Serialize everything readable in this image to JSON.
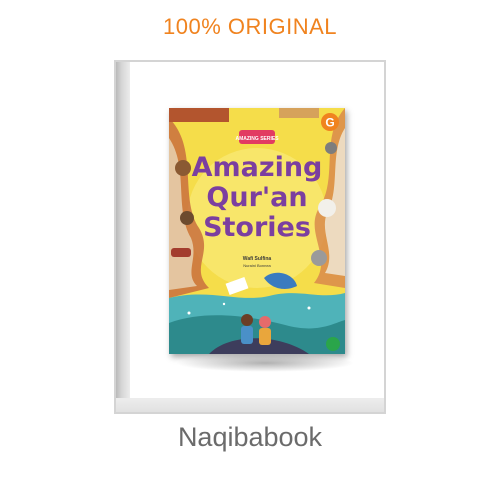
{
  "header": {
    "label": "100% ORIGINAL",
    "color": "#f0831f"
  },
  "footer": {
    "label": "Naqibabook",
    "color": "#6b6b6b"
  },
  "book": {
    "series": "AMAZING SERIES",
    "title_line1": "Amazing",
    "title_line2": "Qur'an",
    "title_line3": "Stories",
    "author": "Wafi Sulfina",
    "illustrator": "Nuraini Bonnea",
    "publisher_mark": "G",
    "colors": {
      "title": "#7b3fa0",
      "background": "#f5dd4a",
      "mark": "#f0831f"
    }
  }
}
